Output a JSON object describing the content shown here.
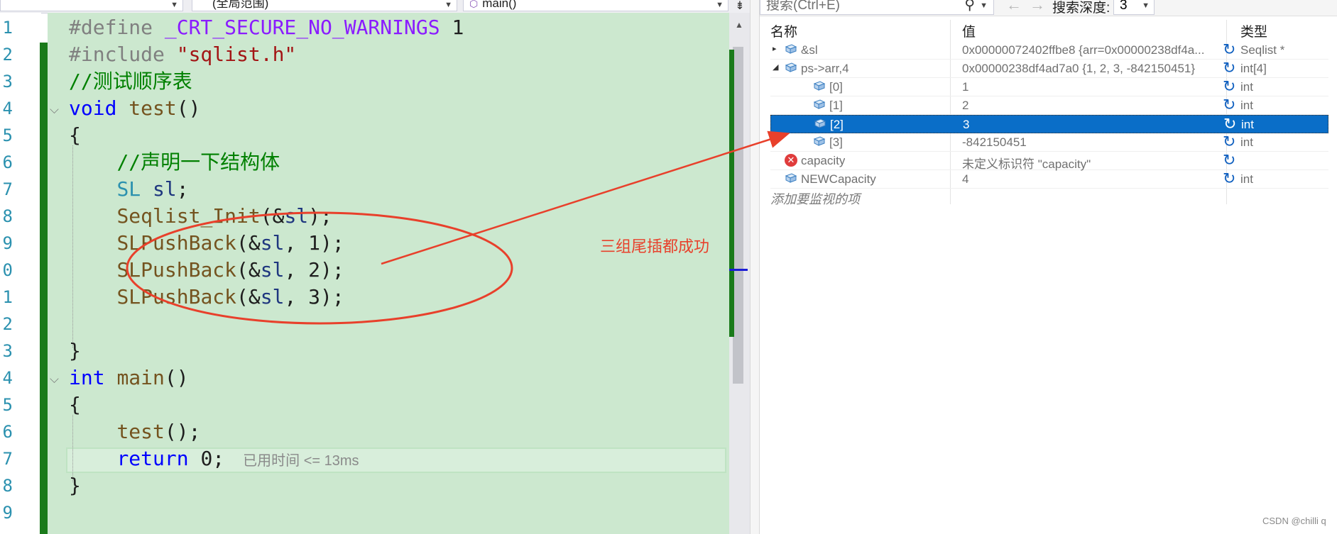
{
  "nav": {
    "scope_selector": "(全局范围)",
    "function_selector": "main()"
  },
  "editor": {
    "line_numbers": [
      "1",
      "2",
      "3",
      "4",
      "5",
      "6",
      "7",
      "8",
      "9",
      "0",
      "1",
      "2",
      "3",
      "4",
      "5",
      "6",
      "7",
      "8",
      "9"
    ],
    "lines": [
      [
        "#define ",
        "_CRT_SECURE_NO_WARNINGS",
        " 1"
      ],
      [
        "#include ",
        "\"sqlist.h\""
      ],
      [
        "//测试顺序表"
      ],
      [
        "void",
        " ",
        "test",
        "()"
      ],
      [
        "{"
      ],
      [
        "    ",
        "//声明一下结构体"
      ],
      [
        "    ",
        "SL",
        " ",
        "sl",
        ";"
      ],
      [
        "    ",
        "Seqlist_Init",
        "(&",
        "sl",
        ");"
      ],
      [
        "    ",
        "SLPushBack",
        "(&",
        "sl",
        ", 1);"
      ],
      [
        "    ",
        "SLPushBack",
        "(&",
        "sl",
        ", 2);"
      ],
      [
        "    ",
        "SLPushBack",
        "(&",
        "sl",
        ", 3);"
      ],
      [
        ""
      ],
      [
        "}"
      ],
      [
        "int",
        " ",
        "main",
        "()"
      ],
      [
        "{"
      ],
      [
        "    ",
        "test",
        "();"
      ],
      [
        "    ",
        "return",
        " 0;"
      ],
      [
        "}"
      ],
      [
        ""
      ]
    ],
    "perf_tip": "已用时间 <= 13ms"
  },
  "watch": {
    "search_placeholder": "搜索(Ctrl+E)",
    "search_depth_label": "搜索深度:",
    "search_depth_value": "3",
    "columns": [
      "名称",
      "值",
      "类型"
    ],
    "rows": [
      {
        "name": "&sl",
        "value": "0x00000072402ffbe8 {arr=0x00000238df4a...",
        "type": "Seqlist *"
      },
      {
        "name": "ps->arr,4",
        "value": "0x00000238df4ad7a0 {1, 2, 3, -842150451}",
        "type": "int[4]"
      },
      {
        "name": "[0]",
        "value": "1",
        "type": "int"
      },
      {
        "name": "[1]",
        "value": "2",
        "type": "int"
      },
      {
        "name": "[2]",
        "value": "3",
        "type": "int"
      },
      {
        "name": "[3]",
        "value": "-842150451",
        "type": "int"
      },
      {
        "name": "capacity",
        "value": "未定义标识符 \"capacity\"",
        "type": ""
      },
      {
        "name": "NEWCapacity",
        "value": "4",
        "type": "int"
      }
    ],
    "add_item_hint": "添加要监视的项"
  },
  "annotation": {
    "label": "三组尾插都成功",
    "color": "#e8402b"
  },
  "watermark": "CSDN @chilli q"
}
